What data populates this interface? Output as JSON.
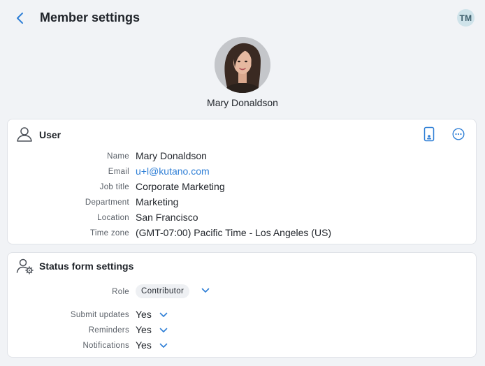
{
  "header": {
    "title": "Member settings",
    "user_initials": "TM"
  },
  "profile": {
    "name": "Mary Donaldson"
  },
  "user_card": {
    "title": "User",
    "fields": [
      {
        "label": "Name",
        "value": "Mary Donaldson"
      },
      {
        "label": "Email",
        "value": "u+l@kutano.com"
      },
      {
        "label": "Job title",
        "value": "Corporate Marketing"
      },
      {
        "label": "Department",
        "value": "Marketing"
      },
      {
        "label": "Location",
        "value": "San Francisco"
      },
      {
        "label": "Time zone",
        "value": "(GMT-07:00) Pacific Time - Los Angeles (US)"
      }
    ]
  },
  "status_card": {
    "title": "Status form settings",
    "role": {
      "label": "Role",
      "value": "Contributor"
    },
    "settings": [
      {
        "label": "Submit updates",
        "value": "Yes"
      },
      {
        "label": "Reminders",
        "value": "Yes"
      },
      {
        "label": "Notifications",
        "value": "Yes"
      }
    ]
  },
  "colors": {
    "accent": "#2f7fd6",
    "background": "#f1f3f6",
    "card": "#ffffff"
  },
  "icons": {
    "back": "chevron-left-icon",
    "user": "user-outline-icon",
    "mobile": "mobile-badge-icon",
    "more": "more-horizontal-icon",
    "status": "user-gear-icon",
    "dropdown": "chevron-down-icon"
  }
}
